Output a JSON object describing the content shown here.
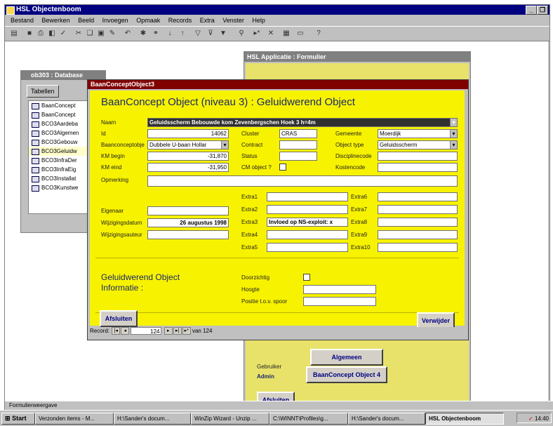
{
  "app": {
    "title": "HSL Objectenboom",
    "menu": [
      "Bestand",
      "Bewerken",
      "Beeld",
      "Invoegen",
      "Opmaak",
      "Records",
      "Extra",
      "Venster",
      "Help"
    ]
  },
  "db_window": {
    "title": "ob303 : Database",
    "tab": "Tabellen",
    "items": [
      "BaanConcept",
      "BaanConcept",
      "BCO3Aardeba",
      "BCO3Algemen",
      "BCO3Gebouw",
      "BCO3Geluidw",
      "BCO3InfraDer",
      "BCO3InfraEig",
      "BCO3Installat",
      "BCO3Kunstwe"
    ]
  },
  "hsl_form": {
    "title": "HSL Applicatie : Formulier",
    "gebruiker_label": "Gebruiker",
    "gebruiker_value": "Admin",
    "btn_algemeen": "Algemeen",
    "btn_baanconcept": "BaanConcept Object 4",
    "btn_afsluiten": "Afsluiten"
  },
  "bc_form": {
    "window_title": "BaanConceptObject3",
    "heading": "BaanConcept Object (niveau 3) : Geluidwerend Object",
    "naam_label": "Naam",
    "naam_value": "Geluidsscherm Bebouwde kom Zevenbergschen Hoek 3 h=4m",
    "id_label": "Id",
    "id_value": "14062",
    "cluster_label": "Cluster",
    "cluster_value": "CRAS",
    "gemeente_label": "Gemeente",
    "gemeente_value": "Moerdijk",
    "baanconcept_label": "Baanconceptobje",
    "baanconcept_value": "Dubbele U-baan Hollar",
    "contract_label": "Contract",
    "objecttype_label": "Object type",
    "objecttype_value": "Geluidsscherm",
    "kmbegin_label": "KM begin",
    "kmbegin_value": "-31,870",
    "status_label": "Status",
    "discipline_label": "Disciplinecode",
    "kmeind_label": "KM eind",
    "kmeind_value": "-31,950",
    "cmobject_label": "CM object ?",
    "kostencode_label": "Kostencode",
    "opmerking_label": "Opmerking",
    "extra": [
      {
        "label": "Extra1",
        "value": ""
      },
      {
        "label": "Extra2",
        "value": ""
      },
      {
        "label": "Extra3",
        "value": "Invloed op NS-exploit: x"
      },
      {
        "label": "Extra4",
        "value": ""
      },
      {
        "label": "Extra5",
        "value": ""
      },
      {
        "label": "Extra6",
        "value": ""
      },
      {
        "label": "Extra7",
        "value": ""
      },
      {
        "label": "Extra8",
        "value": ""
      },
      {
        "label": "Extra9",
        "value": ""
      },
      {
        "label": "Extra10",
        "value": ""
      }
    ],
    "eigenaar_label": "Eigenaar",
    "wijzigingsdatum_label": "Wijzigingsdatum",
    "wijzigingsdatum_value": "26 augustus 1998",
    "wijzigingsauteur_label": "Wijzigingsauteur",
    "info_heading_1": "Geluidwerend Object",
    "info_heading_2": "Informatie :",
    "doorzichtig_label": "Doorzichtig",
    "hoogte_label": "Hoogte",
    "positie_label": "Positie t.o.v. spoor",
    "btn_afsluiten": "Afsluiten",
    "btn_verwijder": "Verwijder",
    "record_label": "Record:",
    "record_value": "124",
    "record_van": "van",
    "record_total": "124"
  },
  "status": {
    "text": "Formulierweergave"
  },
  "taskbar": {
    "start": "Start",
    "tasks": [
      "Verzonden items - M...",
      "H:\\Sander's docum...",
      "WinZip Wizard - Unzip ...",
      "C:\\WINNT\\Profiles\\g...",
      "H:\\Sander's docum...",
      "HSL Objectenboom"
    ],
    "clock": "14:40"
  }
}
